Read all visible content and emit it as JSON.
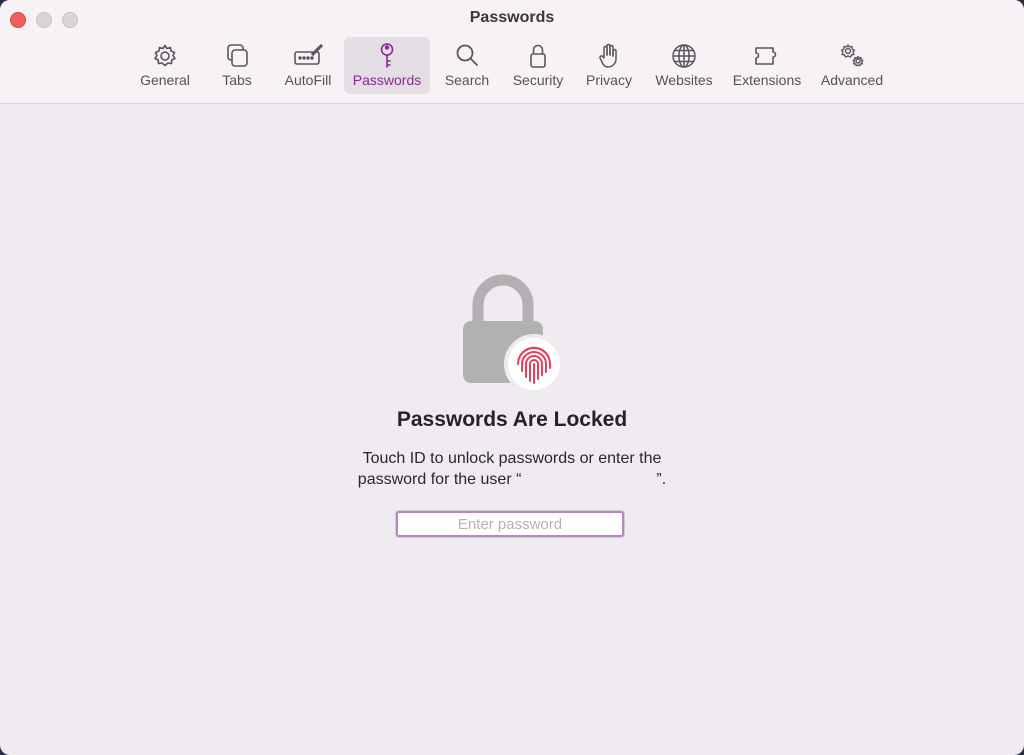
{
  "window": {
    "title": "Passwords"
  },
  "toolbar": {
    "items": [
      {
        "label": "General",
        "icon": "gear-icon"
      },
      {
        "label": "Tabs",
        "icon": "tabs-icon"
      },
      {
        "label": "AutoFill",
        "icon": "autofill-icon"
      },
      {
        "label": "Passwords",
        "icon": "key-icon",
        "selected": true
      },
      {
        "label": "Search",
        "icon": "search-icon"
      },
      {
        "label": "Security",
        "icon": "lock-icon"
      },
      {
        "label": "Privacy",
        "icon": "hand-icon"
      },
      {
        "label": "Websites",
        "icon": "globe-icon"
      },
      {
        "label": "Extensions",
        "icon": "puzzle-icon"
      },
      {
        "label": "Advanced",
        "icon": "gears-icon"
      }
    ]
  },
  "main": {
    "headline": "Passwords Are Locked",
    "description_line1": "Touch ID to unlock passwords or enter the",
    "description_line2_prefix": "password for the user “",
    "description_line2_suffix": "”.",
    "password_placeholder": "Enter password",
    "password_value": ""
  },
  "colors": {
    "accent": "#8a2a92",
    "fingerprint": "#e8405a",
    "lock": "#b3b0b3",
    "close_button": "#f0605a"
  }
}
